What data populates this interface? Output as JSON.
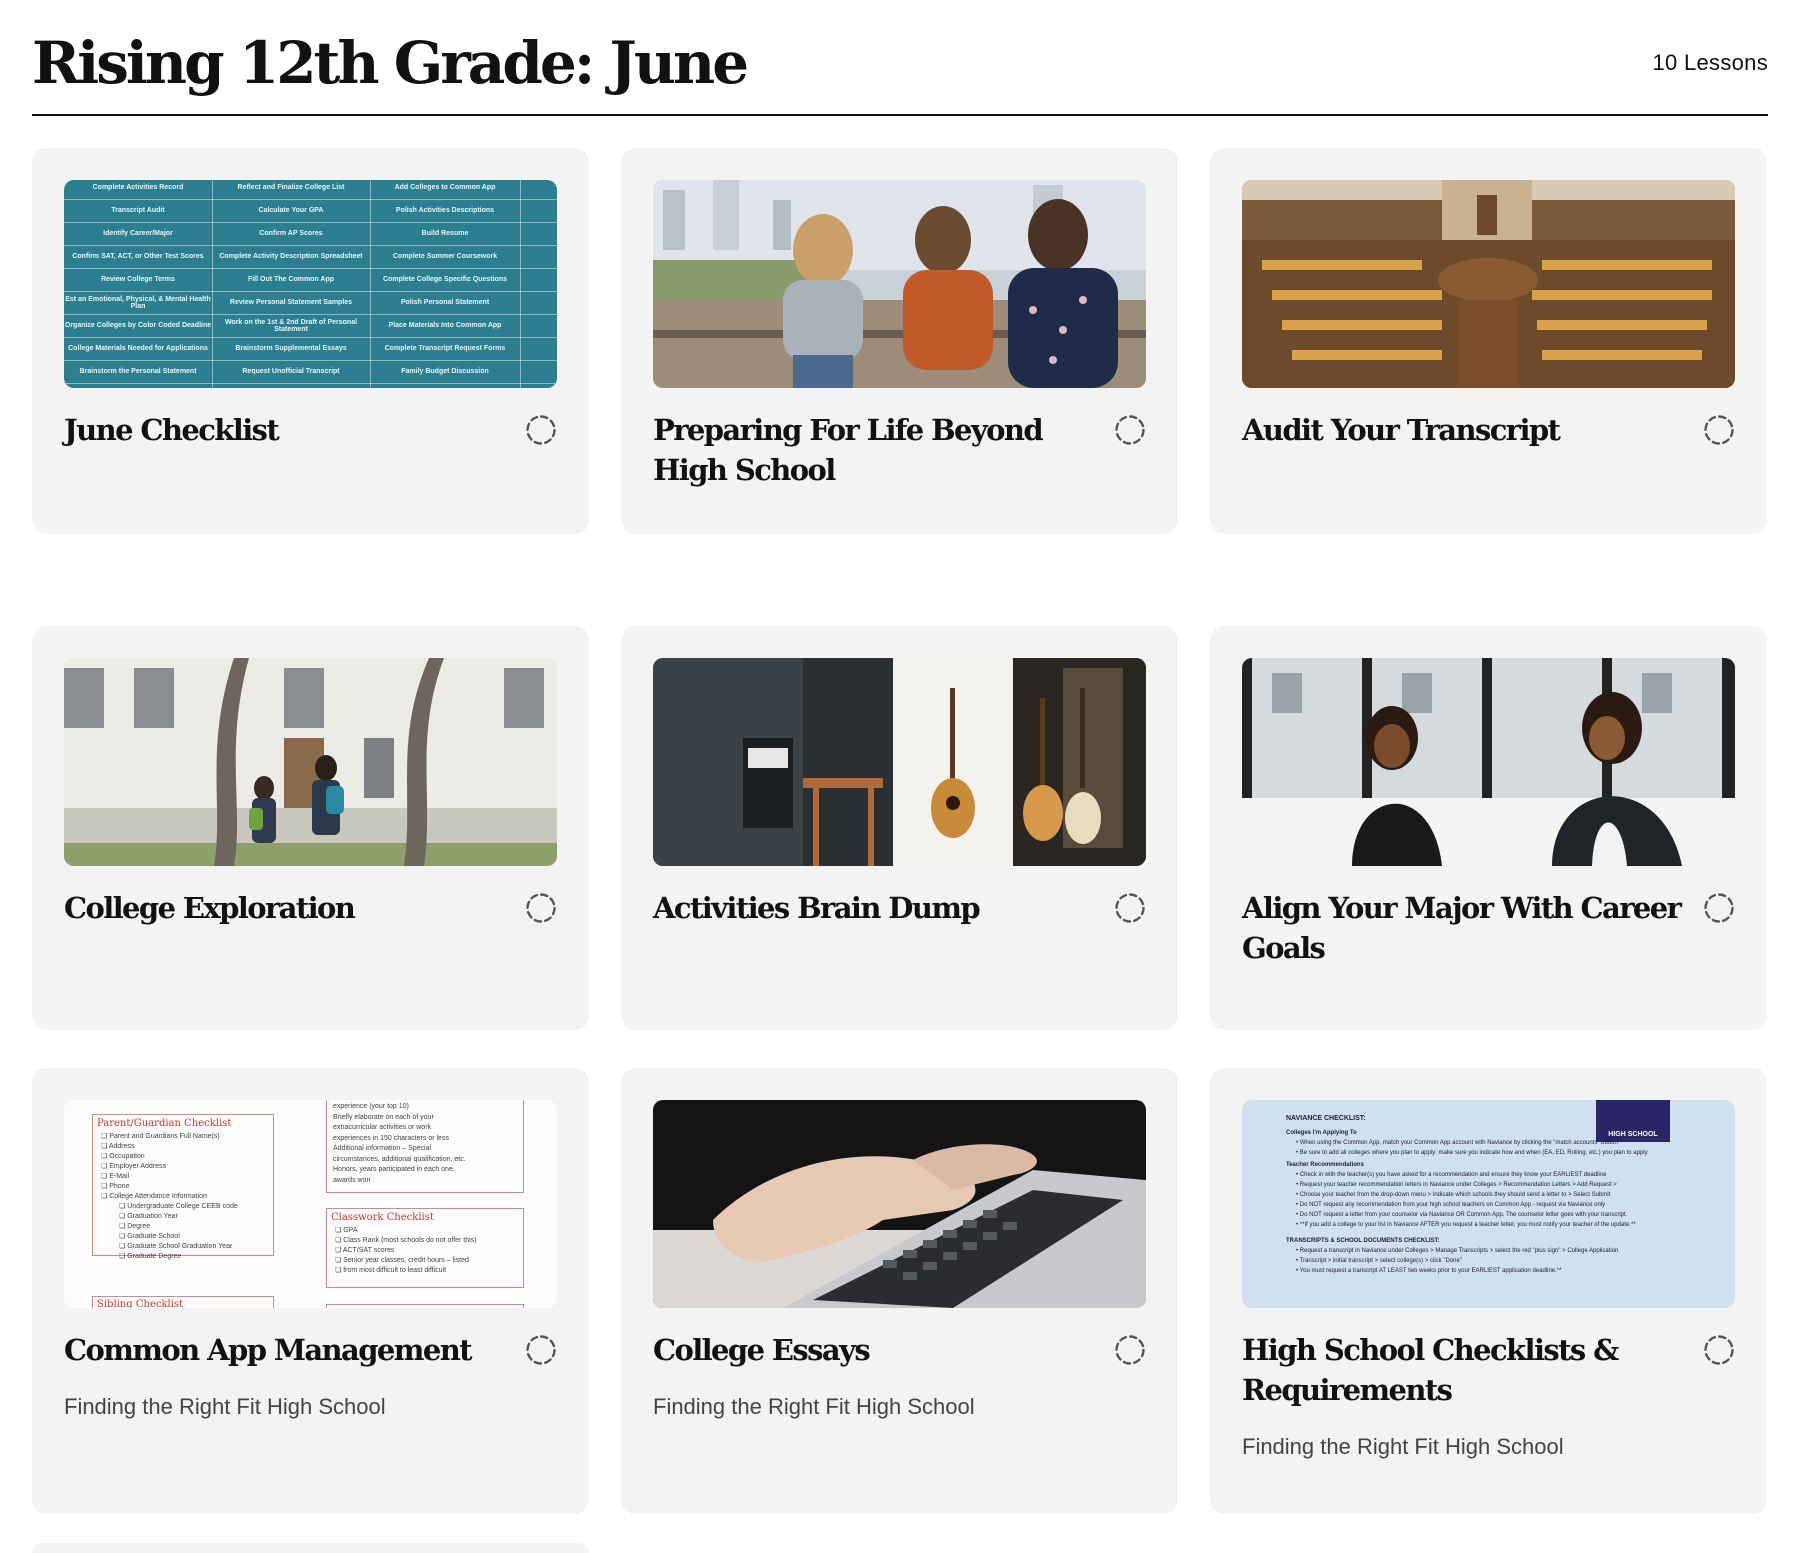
{
  "header": {
    "title": "Rising 12th Grade: June",
    "lesson_count": "10 Lessons"
  },
  "lessons": [
    {
      "title": "June Checklist",
      "subtitle": "",
      "status_icon": "dashed-circle-icon"
    },
    {
      "title": "Preparing For Life Beyond High School",
      "subtitle": "",
      "status_icon": "dashed-circle-icon"
    },
    {
      "title": "Audit Your Transcript",
      "subtitle": "",
      "status_icon": "dashed-circle-icon"
    },
    {
      "title": "College Exploration",
      "subtitle": "",
      "status_icon": "dashed-circle-icon"
    },
    {
      "title": "Activities Brain Dump",
      "subtitle": "",
      "status_icon": "dashed-circle-icon"
    },
    {
      "title": "Align Your Major With Career Goals",
      "subtitle": "",
      "status_icon": "dashed-circle-icon"
    },
    {
      "title": "Common App Management",
      "subtitle": "Finding the Right Fit High School",
      "status_icon": "dashed-circle-icon"
    },
    {
      "title": "College Essays",
      "subtitle": "Finding the Right Fit High School",
      "status_icon": "dashed-circle-icon"
    },
    {
      "title": "High School Checklists & Requirements",
      "subtitle": "Finding the Right Fit High School",
      "status_icon": "dashed-circle-icon"
    }
  ],
  "june_checklist_thumb": {
    "rows": [
      [
        "Complete Activities Record",
        "Reflect and Finalize College List",
        "Add Colleges to Common App"
      ],
      [
        "Transcript Audit",
        "Calculate Your GPA",
        "Polish Activities Descriptions"
      ],
      [
        "Identify Career/Major",
        "Confirm AP Scores",
        "Build Resume"
      ],
      [
        "Confirm SAT, ACT, or Other Test Scores",
        "Complete Activity Description Spreadsheet",
        "Complete Summer Coursework"
      ],
      [
        "Review College Terms",
        "Fill Out The Common App",
        "Complete College Specific Questions"
      ],
      [
        "Est an Emotional, Physical, & Mental Health Plan",
        "Review Personal Statement Samples",
        "Polish Personal Statement"
      ],
      [
        "Organize Colleges by Color Coded Deadline",
        "Work on the 1st & 2nd Draft of Personal Statement",
        "Place Materials Into Common App"
      ],
      [
        "College Materials Needed for Applications",
        "Brainstorm Supplemental Essays",
        "Complete Transcript Request Forms"
      ],
      [
        "Brainstorm the Personal Statement",
        "Request Unofficial Transcript",
        "Family Budget Discussion"
      ]
    ]
  },
  "common_app_thumb": {
    "left_heading": "Parent/Guardian Checklist",
    "left_items": [
      "Parent and Guardians Full Name(s)",
      "Address",
      "Occupation",
      "Employer Address",
      "E-Mail",
      "Phone",
      "College Attendance Information"
    ],
    "left_subitems": [
      "Undergraduate College CEEB code",
      "Graduation Year",
      "Degree",
      "Graduate School",
      "Graduate School Graduation Year",
      "Graduate Degree"
    ],
    "left_footer": "Sibling Checklist",
    "right_top_lines": [
      "experience (your top 10)",
      "Briefly elaborate on each of your",
      "extracurricular activities or work",
      "experiences in 150 characters or less",
      "Additional information – Special",
      "circumstances, additional qualification, etc.",
      "Honors, years participated in each one,",
      "awards won"
    ],
    "right_heading": "Classwork Checklist",
    "right_items": [
      "GPA",
      "Class Rank (most schools do not offer this)",
      "ACT/SAT scores",
      "Senior year classes, credit hours – listed",
      "from most difficult to least difficult"
    ]
  },
  "hs_checklist_thumb": {
    "badge": "HIGH SCHOOL",
    "heading1": "NAVIANCE CHECKLIST:",
    "sub1": "Colleges I'm Applying To",
    "lines1": [
      "When using the Common App, match your Common App account with Naviance by clicking the \"match accounts\" button",
      "Be sure to add all colleges where you plan to apply: make sure you indicate how and when (EA, ED, Rolling, etc.) you plan to apply"
    ],
    "sub2": "Teacher Recommendations",
    "lines2": [
      "Check in with the teacher(s) you have asked for a recommendation and ensure they know your EARLIEST deadline",
      "Request your teacher recommendation letters in Naviance under Colleges > Recommendation Letters > Add Request >",
      "Choose your teacher from the drop-down menu > Indicate which schools they should send a letter to > Select Submit",
      "Do NOT request any recommendation from your high school teachers on Common App - request via Naviance only",
      "Do NOT request a letter from your counselor via Naviance OR Common App. The counselor letter goes with your transcript.",
      "**If you add a college to your list in Naviance AFTER you request a teacher letter, you must notify your teacher of the update.**"
    ],
    "heading2": "TRANSCRIPTS & SCHOOL DOCUMENTS CHECKLIST:",
    "lines3": [
      "Request a transcript in Naviance under Colleges > Manage Transcripts > select the red \"plus sign\" > College Application",
      "Transcript > initial transcript > select college(s) > click \"Done\"",
      "You must request a transcript AT LEAST two weeks prior to your EARLIEST application deadline.**"
    ]
  },
  "colors": {
    "card_bg": "#f3f3f3",
    "checklist_teal": "#2c7f90",
    "doc_red": "#c0392b",
    "doc_blue": "#cfe0f0"
  }
}
